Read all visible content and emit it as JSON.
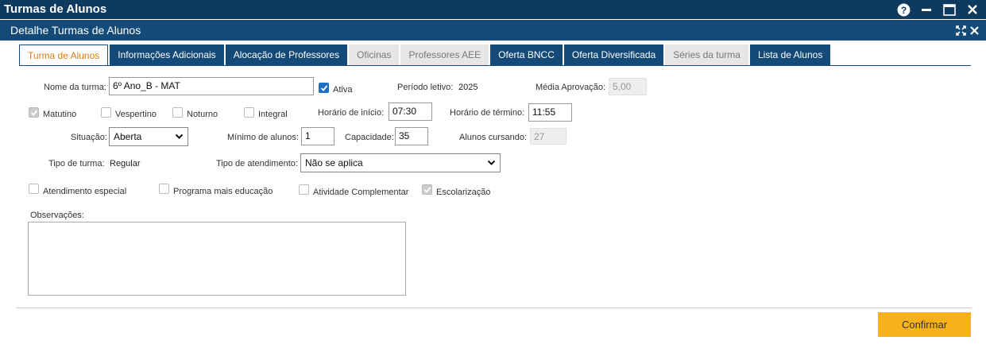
{
  "window": {
    "title": "Turmas de Alunos"
  },
  "panel": {
    "title": "Detalhe Turmas de Alunos"
  },
  "tabs": [
    {
      "label": "Turma de Alunos",
      "state": "active"
    },
    {
      "label": "Informações Adicionais",
      "state": "enabled"
    },
    {
      "label": "Alocação de Professores",
      "state": "enabled"
    },
    {
      "label": "Oficinas",
      "state": "disabled"
    },
    {
      "label": "Professores AEE",
      "state": "disabled"
    },
    {
      "label": "Oferta BNCC",
      "state": "enabled"
    },
    {
      "label": "Oferta Diversificada",
      "state": "enabled"
    },
    {
      "label": "Séries da turma",
      "state": "disabled"
    },
    {
      "label": "Lista de Alunos",
      "state": "enabled"
    }
  ],
  "form": {
    "nome_label": "Nome da turma:",
    "nome_value": "6º Ano_B - MAT",
    "ativa_label": "Ativa",
    "periodo_label": "Período letivo:",
    "periodo_value": "2025",
    "media_label": "Média Aprovação:",
    "media_value": "5,00",
    "matutino_label": "Matutino",
    "vespertino_label": "Vespertino",
    "noturno_label": "Noturno",
    "integral_label": "Integral",
    "inicio_label": "Horário de início:",
    "inicio_value": "07:30",
    "termino_label": "Horário de término:",
    "termino_value": "11:55",
    "situacao_label": "Situação:",
    "situacao_value": "Aberta",
    "minimo_label": "Mínimo de alunos:",
    "minimo_value": "1",
    "capacidade_label": "Capacidade:",
    "capacidade_value": "35",
    "cursando_label": "Alunos cursando:",
    "cursando_value": "27",
    "tipo_turma_label": "Tipo de turma:",
    "tipo_turma_value": "Regular",
    "tipo_atend_label": "Tipo de atendimento:",
    "tipo_atend_value": "Não se aplica",
    "atend_especial_label": "Atendimento especial",
    "programa_label": "Programa mais educação",
    "atividade_label": "Atividade Complementar",
    "escolarizacao_label": "Escolarização",
    "observacoes_label": "Observações:"
  },
  "footer": {
    "confirm_label": "Confirmar"
  },
  "colors": {
    "titlebar": "#0d3a5e",
    "tab_active_text": "#e47911",
    "tab_enabled": "#144a78",
    "confirm": "#f7b21b"
  }
}
